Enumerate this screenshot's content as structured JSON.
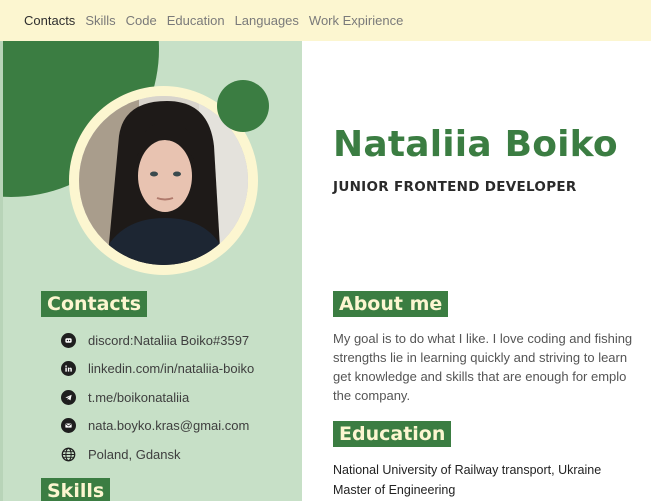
{
  "nav": {
    "items": [
      "Contacts",
      "Skills",
      "Code",
      "Education",
      "Languages",
      "Work Expirience"
    ],
    "active_index": 0
  },
  "header": {
    "name": "Nataliia Boiko",
    "role": "JUNIOR FRONTEND DEVELOPER"
  },
  "sidebar": {
    "contacts_title": "Contacts",
    "contacts": [
      {
        "icon": "discord-icon",
        "text": "discord:Nataliia Boiko#3597"
      },
      {
        "icon": "linkedin-icon",
        "text": "linkedin.com/in/nataliia-boiko"
      },
      {
        "icon": "telegram-icon",
        "text": "t.me/boikonataliia"
      },
      {
        "icon": "email-icon",
        "text": "nata.boyko.kras@gmai.com"
      },
      {
        "icon": "globe-icon",
        "text": "Poland, Gdansk"
      }
    ],
    "skills_title": "Skills"
  },
  "about": {
    "title": "About me",
    "lines": [
      "My goal is to do what I like. I love coding and fishing",
      "strengths lie in learning quickly and striving to learn",
      "get knowledge and skills that are enough for emplo",
      "the company."
    ]
  },
  "education": {
    "title": "Education",
    "university": "National University of Railway transport, Ukraine",
    "degree": "Master of Engineering"
  },
  "colors": {
    "accent_green": "#3b7d42",
    "sidebar_bg": "#c7e0c7",
    "nav_bg": "#fcf6d0",
    "cream": "#fcf6d0"
  }
}
